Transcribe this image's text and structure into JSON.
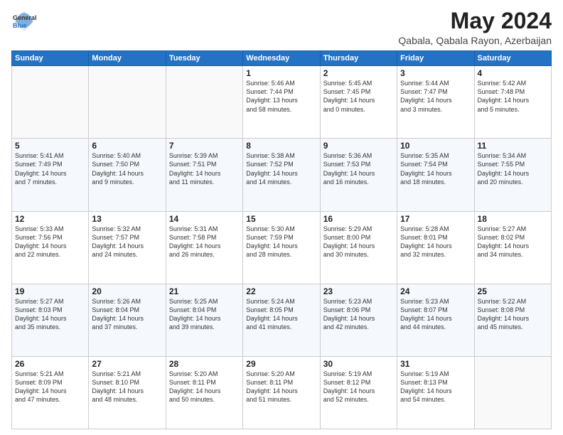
{
  "logo": {
    "general": "General",
    "blue": "Blue"
  },
  "title": "May 2024",
  "location": "Qabala, Qabala Rayon, Azerbaijan",
  "days_of_week": [
    "Sunday",
    "Monday",
    "Tuesday",
    "Wednesday",
    "Thursday",
    "Friday",
    "Saturday"
  ],
  "weeks": [
    [
      {
        "day": "",
        "info": ""
      },
      {
        "day": "",
        "info": ""
      },
      {
        "day": "",
        "info": ""
      },
      {
        "day": "1",
        "info": "Sunrise: 5:46 AM\nSunset: 7:44 PM\nDaylight: 13 hours\nand 58 minutes."
      },
      {
        "day": "2",
        "info": "Sunrise: 5:45 AM\nSunset: 7:45 PM\nDaylight: 14 hours\nand 0 minutes."
      },
      {
        "day": "3",
        "info": "Sunrise: 5:44 AM\nSunset: 7:47 PM\nDaylight: 14 hours\nand 3 minutes."
      },
      {
        "day": "4",
        "info": "Sunrise: 5:42 AM\nSunset: 7:48 PM\nDaylight: 14 hours\nand 5 minutes."
      }
    ],
    [
      {
        "day": "5",
        "info": "Sunrise: 5:41 AM\nSunset: 7:49 PM\nDaylight: 14 hours\nand 7 minutes."
      },
      {
        "day": "6",
        "info": "Sunrise: 5:40 AM\nSunset: 7:50 PM\nDaylight: 14 hours\nand 9 minutes."
      },
      {
        "day": "7",
        "info": "Sunrise: 5:39 AM\nSunset: 7:51 PM\nDaylight: 14 hours\nand 11 minutes."
      },
      {
        "day": "8",
        "info": "Sunrise: 5:38 AM\nSunset: 7:52 PM\nDaylight: 14 hours\nand 14 minutes."
      },
      {
        "day": "9",
        "info": "Sunrise: 5:36 AM\nSunset: 7:53 PM\nDaylight: 14 hours\nand 16 minutes."
      },
      {
        "day": "10",
        "info": "Sunrise: 5:35 AM\nSunset: 7:54 PM\nDaylight: 14 hours\nand 18 minutes."
      },
      {
        "day": "11",
        "info": "Sunrise: 5:34 AM\nSunset: 7:55 PM\nDaylight: 14 hours\nand 20 minutes."
      }
    ],
    [
      {
        "day": "12",
        "info": "Sunrise: 5:33 AM\nSunset: 7:56 PM\nDaylight: 14 hours\nand 22 minutes."
      },
      {
        "day": "13",
        "info": "Sunrise: 5:32 AM\nSunset: 7:57 PM\nDaylight: 14 hours\nand 24 minutes."
      },
      {
        "day": "14",
        "info": "Sunrise: 5:31 AM\nSunset: 7:58 PM\nDaylight: 14 hours\nand 26 minutes."
      },
      {
        "day": "15",
        "info": "Sunrise: 5:30 AM\nSunset: 7:59 PM\nDaylight: 14 hours\nand 28 minutes."
      },
      {
        "day": "16",
        "info": "Sunrise: 5:29 AM\nSunset: 8:00 PM\nDaylight: 14 hours\nand 30 minutes."
      },
      {
        "day": "17",
        "info": "Sunrise: 5:28 AM\nSunset: 8:01 PM\nDaylight: 14 hours\nand 32 minutes."
      },
      {
        "day": "18",
        "info": "Sunrise: 5:27 AM\nSunset: 8:02 PM\nDaylight: 14 hours\nand 34 minutes."
      }
    ],
    [
      {
        "day": "19",
        "info": "Sunrise: 5:27 AM\nSunset: 8:03 PM\nDaylight: 14 hours\nand 35 minutes."
      },
      {
        "day": "20",
        "info": "Sunrise: 5:26 AM\nSunset: 8:04 PM\nDaylight: 14 hours\nand 37 minutes."
      },
      {
        "day": "21",
        "info": "Sunrise: 5:25 AM\nSunset: 8:04 PM\nDaylight: 14 hours\nand 39 minutes."
      },
      {
        "day": "22",
        "info": "Sunrise: 5:24 AM\nSunset: 8:05 PM\nDaylight: 14 hours\nand 41 minutes."
      },
      {
        "day": "23",
        "info": "Sunrise: 5:23 AM\nSunset: 8:06 PM\nDaylight: 14 hours\nand 42 minutes."
      },
      {
        "day": "24",
        "info": "Sunrise: 5:23 AM\nSunset: 8:07 PM\nDaylight: 14 hours\nand 44 minutes."
      },
      {
        "day": "25",
        "info": "Sunrise: 5:22 AM\nSunset: 8:08 PM\nDaylight: 14 hours\nand 45 minutes."
      }
    ],
    [
      {
        "day": "26",
        "info": "Sunrise: 5:21 AM\nSunset: 8:09 PM\nDaylight: 14 hours\nand 47 minutes."
      },
      {
        "day": "27",
        "info": "Sunrise: 5:21 AM\nSunset: 8:10 PM\nDaylight: 14 hours\nand 48 minutes."
      },
      {
        "day": "28",
        "info": "Sunrise: 5:20 AM\nSunset: 8:11 PM\nDaylight: 14 hours\nand 50 minutes."
      },
      {
        "day": "29",
        "info": "Sunrise: 5:20 AM\nSunset: 8:11 PM\nDaylight: 14 hours\nand 51 minutes."
      },
      {
        "day": "30",
        "info": "Sunrise: 5:19 AM\nSunset: 8:12 PM\nDaylight: 14 hours\nand 52 minutes."
      },
      {
        "day": "31",
        "info": "Sunrise: 5:19 AM\nSunset: 8:13 PM\nDaylight: 14 hours\nand 54 minutes."
      },
      {
        "day": "",
        "info": ""
      }
    ]
  ]
}
